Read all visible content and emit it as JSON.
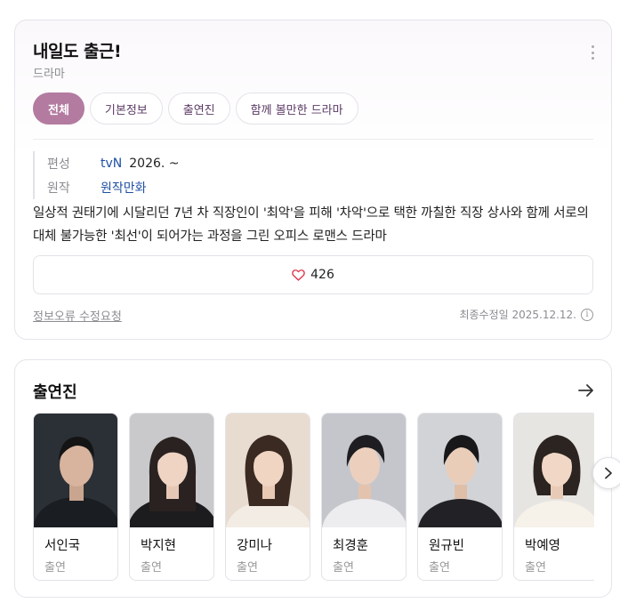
{
  "drama": {
    "title": "내일도 출근!",
    "category": "드라마",
    "menu_icon": "more-vertical-icon"
  },
  "tabs": [
    {
      "label": "전체",
      "active": true
    },
    {
      "label": "기본정보",
      "active": false
    },
    {
      "label": "출연진",
      "active": false
    },
    {
      "label": "함께 볼만한 드라마",
      "active": false
    }
  ],
  "meta": {
    "broadcast_label": "편성",
    "broadcast_channel": "tvN",
    "broadcast_date": "2026. ~",
    "original_label": "원작",
    "original_value": "원작만화"
  },
  "synopsis": "일상적 권태기에 시달리던 7년 차 직장인이 '최악'을 피해 '차악'으로 택한 까칠한 직장 상사와 함께 서로의 대체 불가능한 '최선'이 되어가는 과정을 그린 오피스 로맨스 드라마",
  "like": {
    "count": "426",
    "icon": "heart-icon"
  },
  "footer": {
    "report_link": "정보오류 수정요청",
    "updated": "최종수정일 2025.12.12."
  },
  "cast_section": {
    "title": "출연진",
    "more_icon": "arrow-right-icon",
    "next_icon": "chevron-right-icon",
    "members": [
      {
        "name": "서인국",
        "role": "출연"
      },
      {
        "name": "박지현",
        "role": "출연"
      },
      {
        "name": "강미나",
        "role": "출연"
      },
      {
        "name": "최경훈",
        "role": "출연"
      },
      {
        "name": "원규빈",
        "role": "출연"
      },
      {
        "name": "박예영",
        "role": "출연"
      }
    ]
  },
  "colors": {
    "accent": "#b37ba0",
    "link": "#1f4fa3",
    "heart": "#e0394e"
  }
}
